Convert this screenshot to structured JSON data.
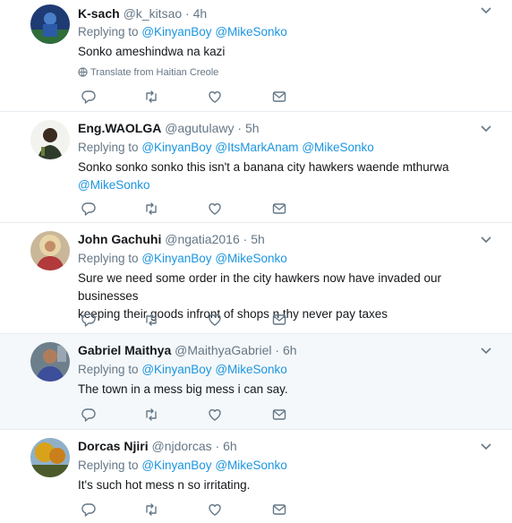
{
  "tweets": [
    {
      "fullname": "K-sach",
      "handle": "@k_kitsao",
      "time": "4h",
      "replying_prefix": "Replying to",
      "mentions": [
        "@KinyanBoy",
        "@MikeSonko"
      ],
      "text": "Sonko ameshindwa na kazi",
      "translate": "Translate from Haitian Creole",
      "avatar_icon": "avatar-k-sach"
    },
    {
      "fullname": "Eng.WAOLGA",
      "handle": "@agutulawy",
      "time": "5h",
      "replying_prefix": "Replying to",
      "mentions": [
        "@KinyanBoy",
        "@ItsMarkAnam",
        "@MikeSonko"
      ],
      "text_line1": "Sonko sonko sonko this isn't a banana city hawkers waende mthurwa",
      "text_mention": "@MikeSonko",
      "avatar_icon": "avatar-eng-waolga"
    },
    {
      "fullname": "John Gachuhi",
      "handle": "@ngatia2016",
      "time": "5h",
      "replying_prefix": "Replying to",
      "mentions": [
        "@KinyanBoy",
        "@MikeSonko"
      ],
      "text_line1": "Sure we need some order in the city hawkers now have invaded our businesses",
      "text_line2": "keeping their goods infront of shops n thy never pay taxes",
      "avatar_icon": "avatar-john-gachuhi"
    },
    {
      "fullname": "Gabriel Maithya",
      "handle": "@MaithyaGabriel",
      "time": "6h",
      "replying_prefix": "Replying to",
      "mentions": [
        "@KinyanBoy",
        "@MikeSonko"
      ],
      "text": "The town in a mess big mess i can say.",
      "avatar_icon": "avatar-gabriel-maithya"
    },
    {
      "fullname": "Dorcas Njiri",
      "handle": "@njdorcas",
      "time": "6h",
      "replying_prefix": "Replying to",
      "mentions": [
        "@KinyanBoy",
        "@MikeSonko"
      ],
      "text": "It's such hot mess n so irritating.",
      "avatar_icon": "avatar-dorcas-njiri"
    }
  ],
  "separator": "·",
  "colors": {
    "link": "#1b95e0",
    "secondary": "#657786",
    "primary": "#14171a",
    "highlight_bg": "#f5f8fa",
    "border": "#e6ecf0"
  },
  "icons": [
    "reply-icon",
    "retweet-icon",
    "like-icon",
    "dm-icon",
    "caret-down-icon",
    "globe-icon"
  ]
}
